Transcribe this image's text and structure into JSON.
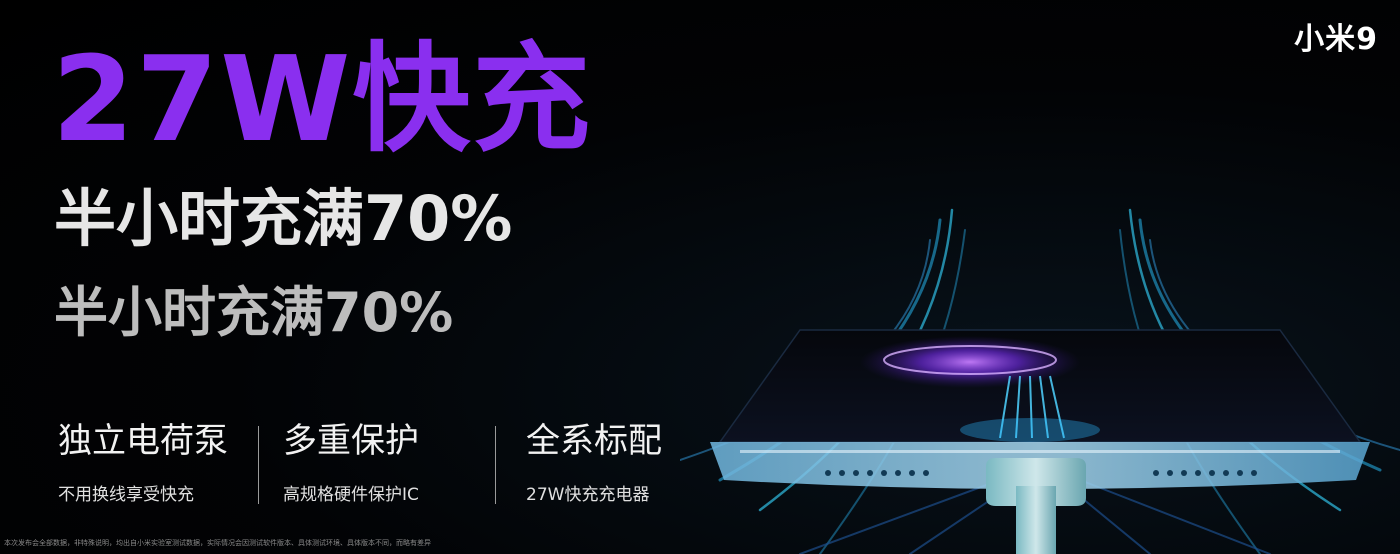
{
  "brand": "小米9",
  "headline": "27W快充",
  "sub_primary": "半小时充满70%",
  "sub_secondary": "半小时充满70%",
  "features": [
    {
      "title": "独立电荷泵",
      "subtitle": "不用换线享受快充"
    },
    {
      "title": "多重保护",
      "subtitle": "高规格硬件保护IC"
    },
    {
      "title": "全系标配",
      "subtitle": "27W快充充电器"
    }
  ],
  "disclaimer": "本次发布会全部数据，非特殊说明，均出自小米实验室测试数据，实际情况会因测试软件版本、具体测试环境、具体版本不同，而略有差异",
  "colors": {
    "accent": "#8a2fef",
    "background": "#000000",
    "charge_glow": "#3ac6ff"
  }
}
